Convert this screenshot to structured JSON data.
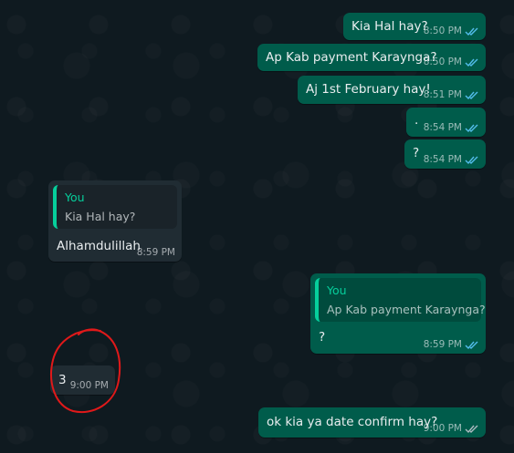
{
  "colors": {
    "outgoing_bubble": "#005c4b",
    "incoming_bubble": "#202c33",
    "chat_background": "#0f1a20",
    "quote_accent": "#06cf9c",
    "read_tick": "#53bdeb",
    "annotation": "#e0191a"
  },
  "icons": {
    "read_receipt": "double-check-icon",
    "annotation": "red-circle-annotation"
  },
  "messages": [
    {
      "direction": "outgoing",
      "text": "Kia Hal hay?",
      "time": "8:50 PM",
      "status": "read"
    },
    {
      "direction": "outgoing",
      "text": "Ap Kab payment Karaynga?",
      "time": "8:50 PM",
      "status": "read"
    },
    {
      "direction": "outgoing",
      "text": "Aj 1st February hay!",
      "time": "8:51 PM",
      "status": "read"
    },
    {
      "direction": "outgoing",
      "text": ".",
      "time": "8:54 PM",
      "status": "read"
    },
    {
      "direction": "outgoing",
      "text": "?",
      "time": "8:54 PM",
      "status": "read"
    },
    {
      "direction": "incoming",
      "quote": {
        "author": "You",
        "text": "Kia Hal hay?"
      },
      "text": "Alhamdulillah",
      "time": "8:59 PM"
    },
    {
      "direction": "outgoing",
      "quote": {
        "author": "You",
        "text": "Ap Kab payment Karaynga?"
      },
      "text": "?",
      "time": "8:59 PM",
      "status": "read"
    },
    {
      "direction": "incoming",
      "text": "3",
      "time": "9:00 PM",
      "highlighted": true
    },
    {
      "direction": "outgoing",
      "text": "ok kia ya date confirm hay?",
      "time": "9:00 PM",
      "status": "delivered"
    }
  ]
}
